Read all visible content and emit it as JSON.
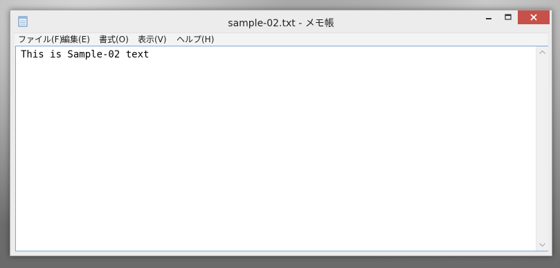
{
  "window": {
    "title": "sample-02.txt - メモ帳",
    "app_icon": "notepad-icon",
    "controls": {
      "minimize_icon": "minimize-icon",
      "maximize_icon": "maximize-icon",
      "close_icon": "close-icon",
      "close_color": "#c7504a"
    }
  },
  "menubar": {
    "items": [
      {
        "label": "ファイル(F)"
      },
      {
        "label": "編集(E)"
      },
      {
        "label": "書式(O)"
      },
      {
        "label": "表示(V)"
      },
      {
        "label": "ヘルプ(H)"
      }
    ]
  },
  "editor": {
    "content": "This is Sample-02 text",
    "border_color": "#7fa6d4"
  },
  "scrollbar": {
    "up_icon": "scroll-up-arrow-icon",
    "down_icon": "scroll-down-arrow-icon"
  }
}
